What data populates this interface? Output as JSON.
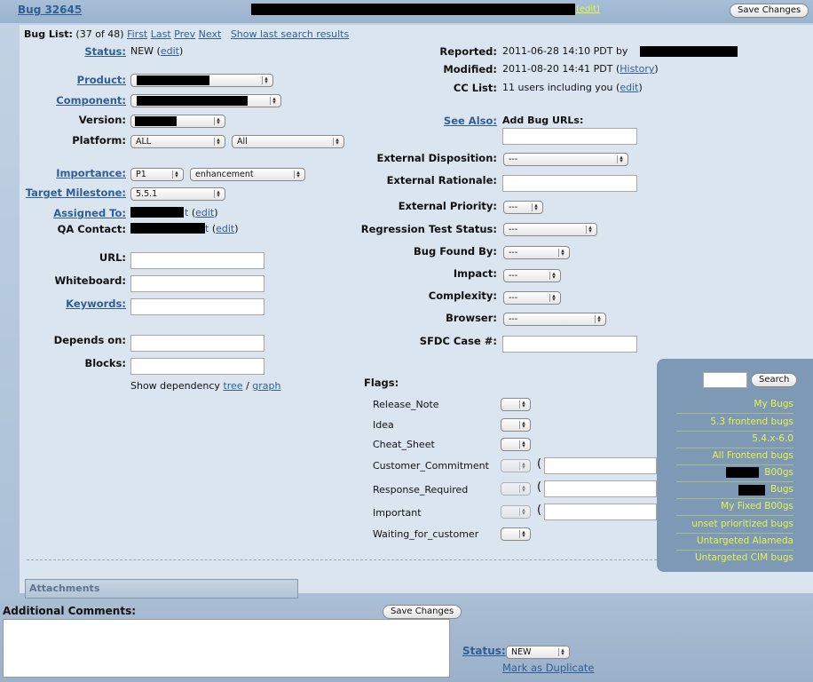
{
  "header": {
    "bug_link": "Bug 32645",
    "separator": " -",
    "edit": "(edit)",
    "save": "Save Changes"
  },
  "buglist": {
    "label": "Bug List:",
    "count": "(37 of 48)",
    "first": "First",
    "last": "Last",
    "prev": "Prev",
    "next": "Next",
    "show_last": "Show last search results"
  },
  "left": {
    "status_label": "Status:",
    "status_value": "NEW",
    "status_edit": "edit",
    "product_label": "Product:",
    "component_label": "Component:",
    "version_label": "Version:",
    "platform_label": "Platform:",
    "platform_a": "ALL",
    "platform_b": "All",
    "importance_label": "Importance:",
    "priority": "P1",
    "severity": "enhancement",
    "milestone_label": "Target Milestone:",
    "milestone": "5.5.1",
    "assigned_label": "Assigned To:",
    "assigned_edit": "edit",
    "qa_label": "QA Contact:",
    "qa_edit": "edit",
    "url_label": "URL:",
    "whiteboard_label": "Whiteboard:",
    "keywords_label": "Keywords:",
    "depends_label": "Depends on:",
    "blocks_label": "Blocks:",
    "dep_text": "Show dependency",
    "tree": "tree",
    "graph": "graph"
  },
  "right": {
    "reported_label": "Reported:",
    "reported_value": "2011-06-28 14:10 PDT by",
    "modified_label": "Modified:",
    "modified_value": "2011-08-20 14:41 PDT",
    "history": "History",
    "cc_label": "CC List:",
    "cc_value": "11 users including you",
    "cc_edit": "edit",
    "see_also_label": "See Also:",
    "add_urls": "Add Bug URLs:",
    "ext_disp_label": "External Disposition:",
    "ext_rat_label": "External Rationale:",
    "ext_pri_label": "External Priority:",
    "regression_label": "Regression Test Status:",
    "found_by_label": "Bug Found By:",
    "impact_label": "Impact:",
    "complexity_label": "Complexity:",
    "browser_label": "Browser:",
    "sfdc_label": "SFDC Case #:",
    "dash_value": "---"
  },
  "flags": {
    "title": "Flags:",
    "items": [
      "Release_Note",
      "Idea",
      "Cheat_Sheet",
      "Customer_Commitment",
      "Response_Required",
      "Important",
      "Waiting_for_customer"
    ]
  },
  "sidebar": {
    "search_btn": "Search",
    "links": [
      "My Bugs",
      "5.3 frontend bugs",
      "5.4.x-6.0",
      "All Frontend bugs",
      "B00gs",
      "Bugs",
      "My Fixed B00gs",
      "unset prioritized bugs",
      "Untargeted Alameda",
      "Untargeted CIM bugs"
    ]
  },
  "bottom": {
    "attachments": "Attachments",
    "comments_label": "Additional Comments:",
    "save": "Save Changes",
    "status_label": "Status:",
    "status_value": "NEW",
    "mark_dup": "Mark as Duplicate"
  }
}
